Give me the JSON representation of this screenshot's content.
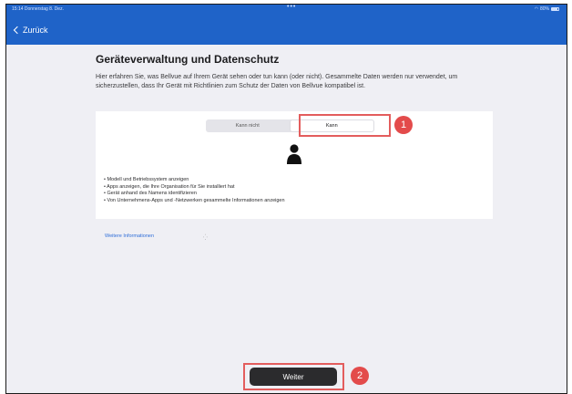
{
  "status_bar": {
    "time_date": "15:14  Donnerstag 8. Dez.",
    "center_dots": "•••",
    "battery": "80%"
  },
  "nav": {
    "back_label": "Zurück"
  },
  "page": {
    "title": "Geräteverwaltung und Datenschutz",
    "description": "Hier erfahren Sie, was Bellvue auf Ihrem Gerät sehen oder tun kann (oder nicht). Gesammelte Daten werden nur verwendet, um sicherzustellen, dass Ihr Gerät mit Richtlinien zum Schutz der Daten von Bellvue kompatibel ist."
  },
  "segments": [
    {
      "label": "Kann nicht",
      "selected": false
    },
    {
      "label": "Kann",
      "selected": true
    }
  ],
  "capabilities": [
    "Modell und Betriebssystem anzeigen",
    "Apps anzeigen, die Ihre Organisation für Sie installiert hat",
    "Gerät anhand des Namens identifizieren",
    "Von Unternehmens-Apps und -Netzwerken gesammelte Informationen anzeigen"
  ],
  "more_info_link": "Weitere Informationen",
  "continue_button": "Weiter",
  "annotations": [
    {
      "number": "1"
    },
    {
      "number": "2"
    }
  ],
  "colors": {
    "accent": "#1f63c8",
    "annotation_red": "#e34b4b",
    "button_dark": "#2b2b2d"
  },
  "icons": {
    "person": "person-silhouette-icon",
    "back": "chevron-left-icon"
  }
}
